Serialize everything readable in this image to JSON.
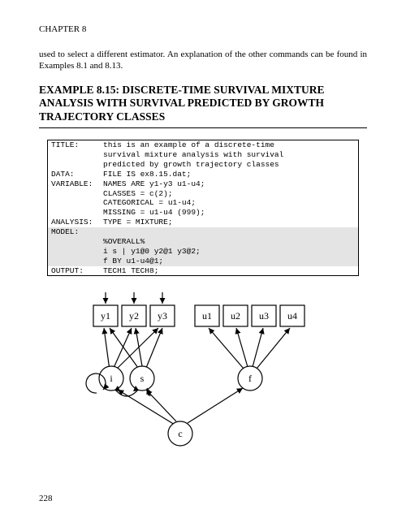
{
  "chapter": "CHAPTER 8",
  "intro": "used to select a different estimator. An explanation of the other commands can be found in Examples 8.1 and 8.13.",
  "title": "EXAMPLE 8.15: DISCRETE-TIME SURVIVAL MIXTURE ANALYSIS WITH SURVIVAL PREDICTED BY GROWTH TRAJECTORY CLASSES",
  "code": {
    "title_label": "TITLE:",
    "title_text1": "this is an example of a discrete-time",
    "title_text2": "survival mixture analysis with survival",
    "title_text3": "predicted by growth trajectory classes",
    "data_label": "DATA:",
    "data_text": "FILE IS ex8.15.dat;",
    "var_label": "VARIABLE:",
    "var_text1": "NAMES ARE y1-y3 u1-u4;",
    "var_text2": "CLASSES = c(2);",
    "var_text3": "CATEGORICAL = u1-u4;",
    "var_text4": "MISSING = u1-u4 (999);",
    "analysis_label": "ANALYSIS:",
    "analysis_text": "TYPE = MIXTURE;",
    "model_label": "MODEL:",
    "model_text1": "%OVERALL%",
    "model_text2": "i s | y1@0 y2@1 y3@2;",
    "model_text3": "f BY u1-u4@1;",
    "output_label": "OUTPUT:",
    "output_text": "TECH1 TECH8;"
  },
  "diagram": {
    "nodes": {
      "y1": "y1",
      "y2": "y2",
      "y3": "y3",
      "u1": "u1",
      "u2": "u2",
      "u3": "u3",
      "u4": "u4",
      "i": "i",
      "s": "s",
      "f": "f",
      "c": "c"
    }
  },
  "page_number": "228"
}
